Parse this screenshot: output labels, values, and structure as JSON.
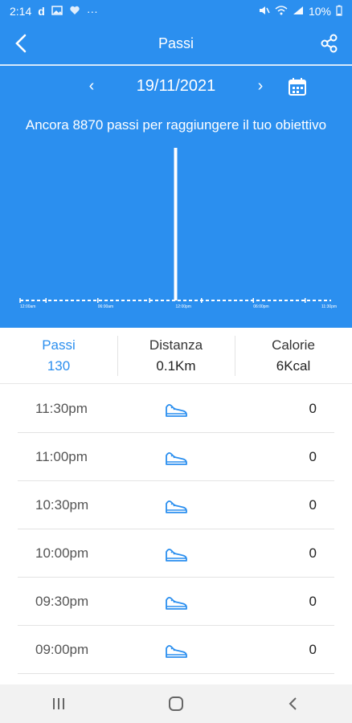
{
  "status_bar": {
    "time": "2:14",
    "indicator_d": "d",
    "dots": "···",
    "battery": "10%"
  },
  "app_bar": {
    "title": "Passi"
  },
  "date_nav": {
    "prev": "‹",
    "date": "19/11/2021",
    "next": "›"
  },
  "goal_message": "Ancora 8870 passi per raggiungere il tuo obiettivo",
  "chart_data": {
    "type": "bar",
    "x_tick_labels": [
      "12:00am",
      "06:00am",
      "12:00pm",
      "06:00pm",
      "11:30pm"
    ],
    "bars": [
      {
        "time": "12:00pm",
        "steps": 130
      }
    ],
    "ylim": [
      0,
      130
    ],
    "grid": false
  },
  "stats": [
    {
      "label": "Passi",
      "value": "130"
    },
    {
      "label": "Distanza",
      "value": "0.1Km"
    },
    {
      "label": "Calorie",
      "value": "6Kcal"
    }
  ],
  "entries": [
    {
      "time": "11:30pm",
      "steps": "0"
    },
    {
      "time": "11:00pm",
      "steps": "0"
    },
    {
      "time": "10:30pm",
      "steps": "0"
    },
    {
      "time": "10:00pm",
      "steps": "0"
    },
    {
      "time": "09:30pm",
      "steps": "0"
    },
    {
      "time": "09:00pm",
      "steps": "0"
    }
  ],
  "colors": {
    "primary": "#2b8fef",
    "active_tab": "#2b8fef"
  },
  "icons": {
    "back": "arrow-left-icon",
    "share": "share-icon",
    "calendar": "calendar-icon",
    "row": "shoe-icon"
  }
}
